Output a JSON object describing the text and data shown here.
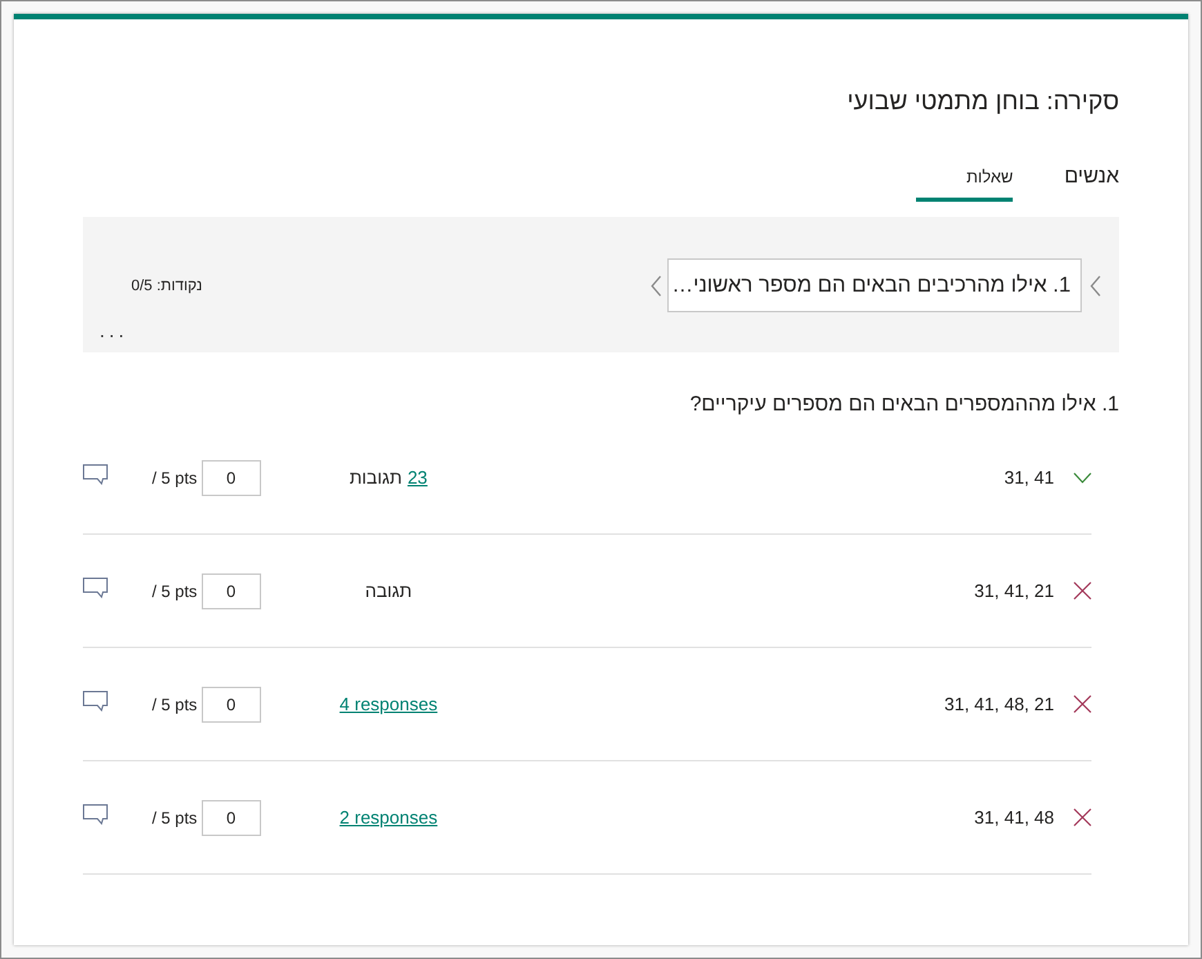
{
  "page": {
    "title": "סקירה: בוחן מתמטי שבועי"
  },
  "tabs": [
    {
      "label": "אנשים",
      "selected": false
    },
    {
      "label": "שאלות",
      "selected": true
    }
  ],
  "question_nav": {
    "current_question": "1. אילו מהרכיבים הבאים הם מספר ראשוני…",
    "points": "נקודות: 0/5",
    "more": "..."
  },
  "question": "1. אילו מההמספרים הבאים הם מספרים עיקריים?",
  "answers": [
    {
      "answer": "31, 41",
      "correct": true,
      "responses_link": "23",
      "responses_label": "תגובות",
      "score": "0",
      "out_of": "/ 5 pts"
    },
    {
      "answer": "31, 41, 21",
      "correct": false,
      "responses_label": "תגובה",
      "score": "0",
      "out_of": "/ 5 pts"
    },
    {
      "answer": "31, 41, 48, 21",
      "correct": false,
      "responses_link": "4 responses",
      "score": "0",
      "out_of": "/ 5 pts"
    },
    {
      "answer": "31, 41, 48",
      "correct": false,
      "responses_link": "2 responses",
      "score": "0",
      "out_of": "/ 5 pts"
    }
  ]
}
